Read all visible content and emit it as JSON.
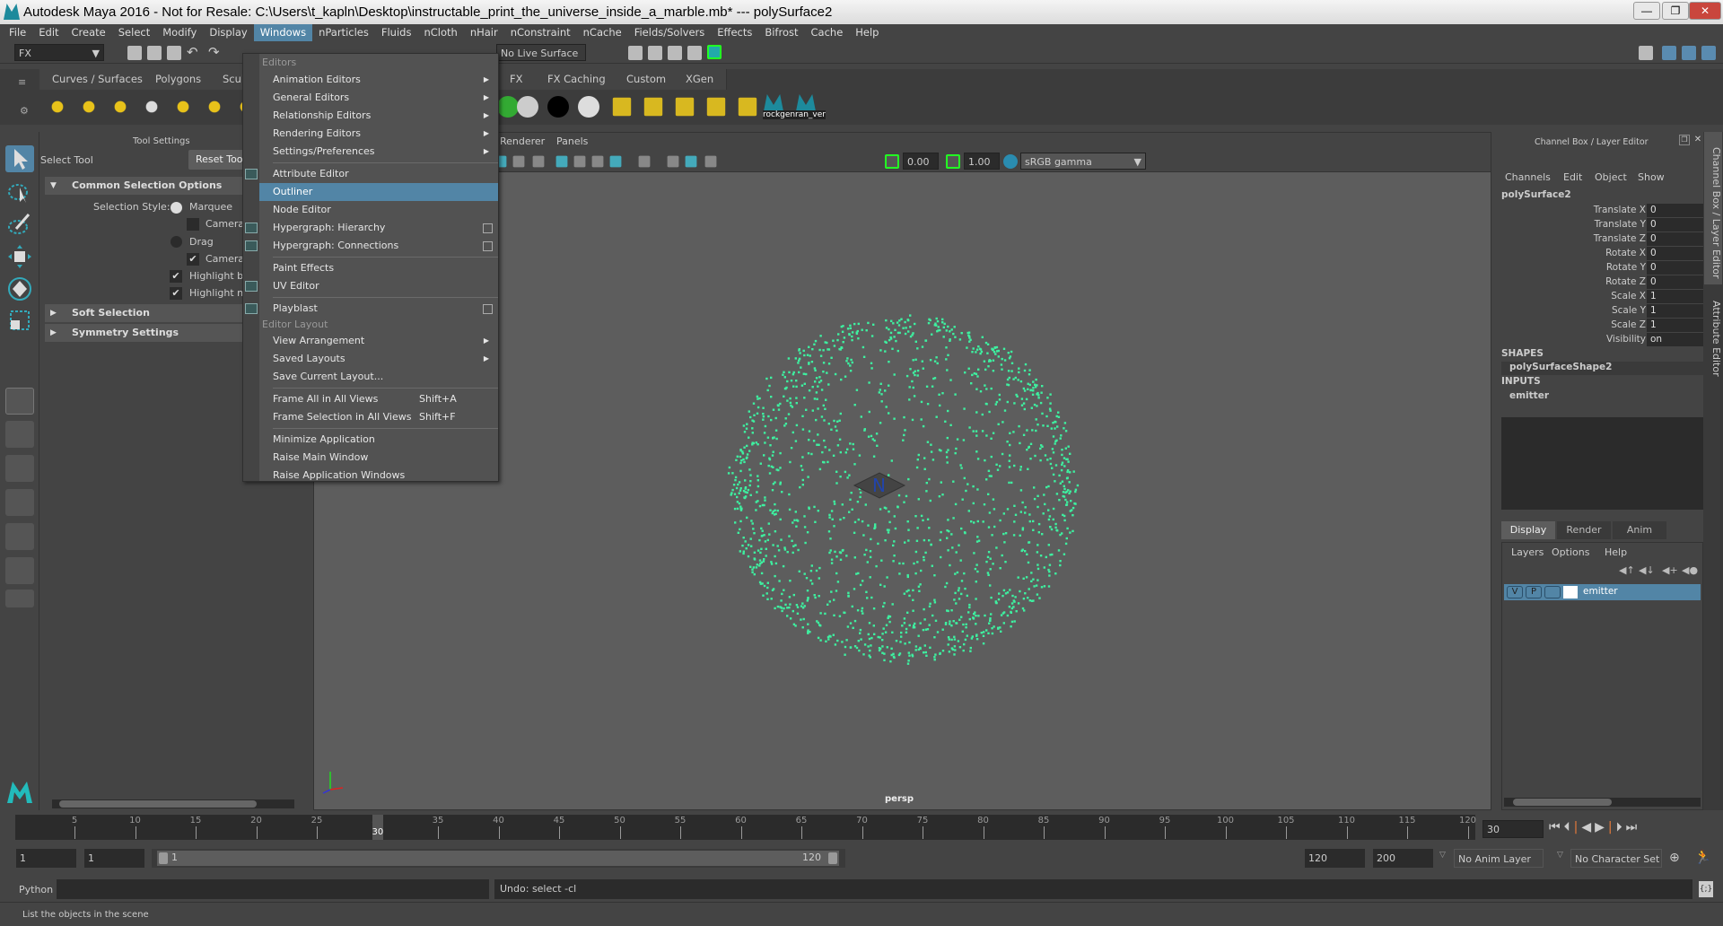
{
  "titlebar": {
    "title": "Autodesk Maya 2016 - Not for Resale: C:\\Users\\t_kapln\\Desktop\\instructable_print_the_universe_inside_a_marble.mb*   ---   polySurface2",
    "minimize": "—",
    "maximize": "❐",
    "close": "✕"
  },
  "menubar": [
    "File",
    "Edit",
    "Create",
    "Select",
    "Modify",
    "Display",
    "Windows",
    "nParticles",
    "Fluids",
    "nCloth",
    "nHair",
    "nConstraint",
    "nCache",
    "Fields/Solvers",
    "Effects",
    "Bifrost",
    "Cache",
    "Help"
  ],
  "menubar_active": "Windows",
  "statusline": {
    "menuset": "FX",
    "live_surface": "No Live Surface"
  },
  "shelf": {
    "tabs": [
      "Curves / Surfaces",
      "Polygons",
      "Sculpting",
      "FX",
      "FX Caching",
      "Custom",
      "XGen"
    ],
    "custom_icons": [
      "rockgen",
      "ran_ver"
    ]
  },
  "tool_settings": {
    "header": "Tool Settings",
    "tool_name": "Select Tool",
    "reset_button": "Reset Tool",
    "sections": {
      "common": "Common Selection Options",
      "soft": "Soft Selection",
      "symmetry": "Symmetry Settings"
    },
    "selection_style_label": "Selection Style:",
    "marquee": "Marquee",
    "camera_based_1": "Camera based selection",
    "drag": "Drag",
    "camera_based_2": "Camera based paint selection",
    "highlight_1": "Highlight backfaces",
    "highlight_2": "Highlight nearest component"
  },
  "windows_menu": {
    "editors_header": "Editors",
    "items": [
      {
        "label": "Animation Editors",
        "submenu": true
      },
      {
        "label": "General Editors",
        "submenu": true
      },
      {
        "label": "Relationship Editors",
        "submenu": true
      },
      {
        "label": "Rendering Editors",
        "submenu": true
      },
      {
        "label": "Settings/Preferences",
        "submenu": true
      },
      {
        "label": "Attribute Editor"
      },
      {
        "label": "Outliner",
        "highlighted": true
      },
      {
        "label": "Node Editor"
      },
      {
        "label": "Hypergraph: Hierarchy",
        "option_box": true
      },
      {
        "label": "Hypergraph: Connections",
        "option_box": true
      },
      {
        "label": "Paint Effects"
      },
      {
        "label": "UV Editor"
      },
      {
        "label": "Playblast",
        "option_box": true
      }
    ],
    "layout_header": "Editor Layout",
    "layout_items": [
      {
        "label": "View Arrangement",
        "submenu": true
      },
      {
        "label": "Saved Layouts",
        "submenu": true
      },
      {
        "label": "Save Current Layout..."
      },
      {
        "label": "Frame All in All Views",
        "shortcut": "Shift+A"
      },
      {
        "label": "Frame Selection in All Views",
        "shortcut": "Shift+F"
      },
      {
        "label": "Minimize Application"
      },
      {
        "label": "Raise Main Window"
      },
      {
        "label": "Raise Application Windows"
      }
    ]
  },
  "viewport": {
    "menus": [
      "Renderer",
      "Panels"
    ],
    "exposure": "0.00",
    "gamma": "1.00",
    "color_space": "sRGB gamma",
    "camera": "persp",
    "particle_color": "#3ef0a0"
  },
  "channel_box": {
    "header": "Channel Box / Layer Editor",
    "menus": [
      "Channels",
      "Edit",
      "Object",
      "Show"
    ],
    "object": "polySurface2",
    "channels": [
      {
        "name": "Translate X",
        "value": "0"
      },
      {
        "name": "Translate Y",
        "value": "0"
      },
      {
        "name": "Translate Z",
        "value": "0"
      },
      {
        "name": "Rotate X",
        "value": "0"
      },
      {
        "name": "Rotate Y",
        "value": "0"
      },
      {
        "name": "Rotate Z",
        "value": "0"
      },
      {
        "name": "Scale X",
        "value": "1"
      },
      {
        "name": "Scale Y",
        "value": "1"
      },
      {
        "name": "Scale Z",
        "value": "1"
      },
      {
        "name": "Visibility",
        "value": "on"
      }
    ],
    "shapes_label": "SHAPES",
    "shape": "polySurfaceShape2",
    "inputs_label": "INPUTS",
    "input": "emitter"
  },
  "layer_editor": {
    "tabs": [
      "Display",
      "Render",
      "Anim"
    ],
    "menus": [
      "Layers",
      "Options",
      "Help"
    ],
    "layer": {
      "v": "V",
      "p": "P",
      "name": "emitter"
    }
  },
  "side_tabs": [
    "Channel Box / Layer Editor",
    "Attribute Editor"
  ],
  "timeline": {
    "start": 1,
    "end": 120,
    "current_frame": 30,
    "current_field": "30",
    "ticks": [
      5,
      10,
      15,
      20,
      25,
      30,
      35,
      40,
      45,
      50,
      55,
      60,
      65,
      70,
      75,
      80,
      85,
      90,
      95,
      100,
      105,
      110,
      115,
      120
    ]
  },
  "range": {
    "start": "1",
    "playback_start": "1",
    "slider_start": "1",
    "slider_end": "120",
    "playback_end": "120",
    "end": "200",
    "anim_layer": "No Anim Layer",
    "character_set": "No Character Set"
  },
  "command_line": {
    "language": "Python",
    "result": "Undo: select -cl"
  },
  "help_line": "List the objects in the scene"
}
